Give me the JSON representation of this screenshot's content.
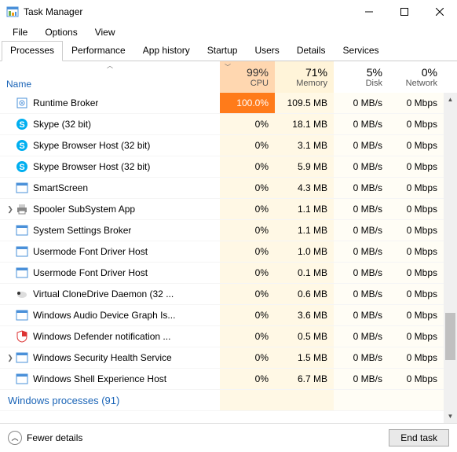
{
  "window": {
    "title": "Task Manager"
  },
  "menu": {
    "file": "File",
    "options": "Options",
    "view": "View"
  },
  "tabs": {
    "processes": "Processes",
    "performance": "Performance",
    "app_history": "App history",
    "startup": "Startup",
    "users": "Users",
    "details": "Details",
    "services": "Services"
  },
  "columns": {
    "name": "Name",
    "cpu_pct": "99%",
    "cpu_lbl": "CPU",
    "mem_pct": "71%",
    "mem_lbl": "Memory",
    "disk_pct": "5%",
    "disk_lbl": "Disk",
    "net_pct": "0%",
    "net_lbl": "Network"
  },
  "processes": [
    {
      "name": "Runtime Broker",
      "cpu": "100.0%",
      "cpu_hot": true,
      "mem": "109.5 MB",
      "disk": "0 MB/s",
      "net": "0 Mbps",
      "icon": "gear-blue"
    },
    {
      "name": "Skype (32 bit)",
      "cpu": "0%",
      "mem": "18.1 MB",
      "disk": "0 MB/s",
      "net": "0 Mbps",
      "icon": "skype"
    },
    {
      "name": "Skype Browser Host (32 bit)",
      "cpu": "0%",
      "mem": "3.1 MB",
      "disk": "0 MB/s",
      "net": "0 Mbps",
      "icon": "skype"
    },
    {
      "name": "Skype Browser Host (32 bit)",
      "cpu": "0%",
      "mem": "5.9 MB",
      "disk": "0 MB/s",
      "net": "0 Mbps",
      "icon": "skype"
    },
    {
      "name": "SmartScreen",
      "cpu": "0%",
      "mem": "4.3 MB",
      "disk": "0 MB/s",
      "net": "0 Mbps",
      "icon": "window-blue"
    },
    {
      "name": "Spooler SubSystem App",
      "cpu": "0%",
      "mem": "1.1 MB",
      "disk": "0 MB/s",
      "net": "0 Mbps",
      "icon": "printer",
      "expandable": true
    },
    {
      "name": "System Settings Broker",
      "cpu": "0%",
      "mem": "1.1 MB",
      "disk": "0 MB/s",
      "net": "0 Mbps",
      "icon": "window-blue"
    },
    {
      "name": "Usermode Font Driver Host",
      "cpu": "0%",
      "mem": "1.0 MB",
      "disk": "0 MB/s",
      "net": "0 Mbps",
      "icon": "window-blue"
    },
    {
      "name": "Usermode Font Driver Host",
      "cpu": "0%",
      "mem": "0.1 MB",
      "disk": "0 MB/s",
      "net": "0 Mbps",
      "icon": "window-blue"
    },
    {
      "name": "Virtual CloneDrive Daemon (32 ...",
      "cpu": "0%",
      "mem": "0.6 MB",
      "disk": "0 MB/s",
      "net": "0 Mbps",
      "icon": "sheep"
    },
    {
      "name": "Windows Audio Device Graph Is...",
      "cpu": "0%",
      "mem": "3.6 MB",
      "disk": "0 MB/s",
      "net": "0 Mbps",
      "icon": "window-blue"
    },
    {
      "name": "Windows Defender notification ...",
      "cpu": "0%",
      "mem": "0.5 MB",
      "disk": "0 MB/s",
      "net": "0 Mbps",
      "icon": "shield"
    },
    {
      "name": "Windows Security Health Service",
      "cpu": "0%",
      "mem": "1.5 MB",
      "disk": "0 MB/s",
      "net": "0 Mbps",
      "icon": "window-blue",
      "expandable": true
    },
    {
      "name": "Windows Shell Experience Host",
      "cpu": "0%",
      "mem": "6.7 MB",
      "disk": "0 MB/s",
      "net": "0 Mbps",
      "icon": "window-blue"
    }
  ],
  "group_label": "Windows processes (91)",
  "footer": {
    "fewer": "Fewer details",
    "end_task": "End task"
  }
}
